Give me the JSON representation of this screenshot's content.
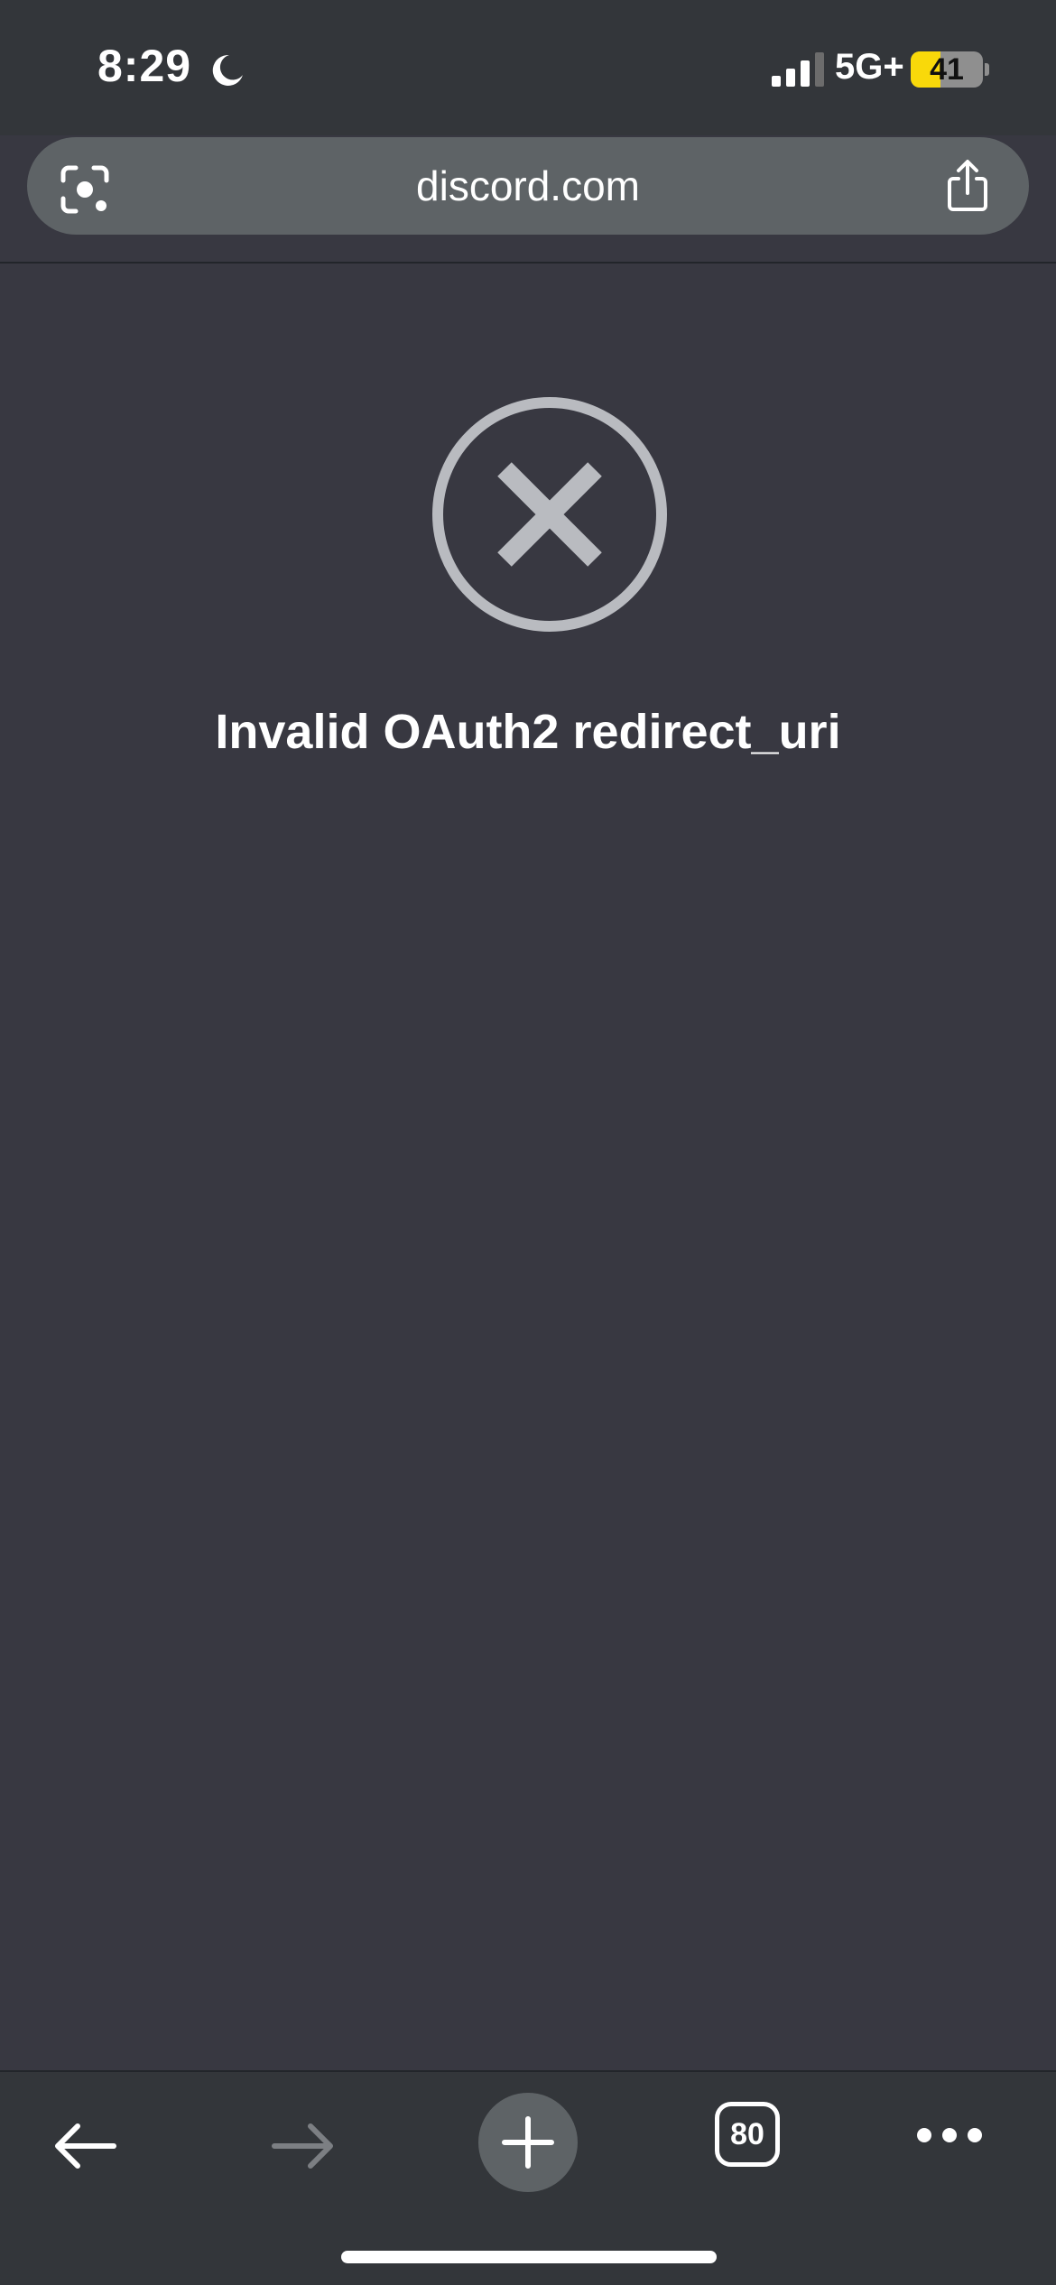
{
  "status_bar": {
    "time": "8:29",
    "network": "5G+",
    "battery_level": "41",
    "battery_fraction": 0.41,
    "icons": [
      "moon-icon",
      "cellular-signal-icon",
      "battery-icon"
    ]
  },
  "url_bar": {
    "url": "discord.com",
    "left_icon": "camera-lens-icon",
    "right_icon": "share-icon"
  },
  "page": {
    "error_icon": "x-circle-icon",
    "error_message": "Invalid OAuth2 redirect_uri"
  },
  "toolbar": {
    "back_icon": "arrow-left-icon",
    "forward_icon": "arrow-right-icon",
    "new_tab_icon": "plus-icon",
    "tab_count": "80",
    "more_icon": "more-horizontal-icon"
  },
  "colors": {
    "page_background": "#383841",
    "chrome_background": "#33363a",
    "url_pill": "#5e6366",
    "error_icon": "#b9bbc0",
    "battery_fill": "#f9d90a"
  }
}
